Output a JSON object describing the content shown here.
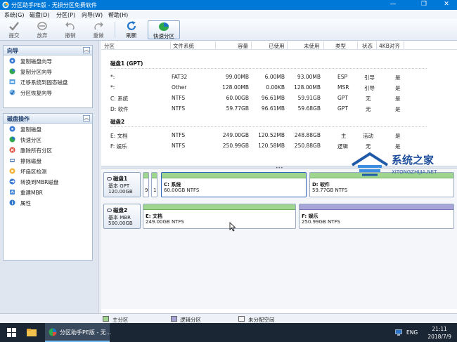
{
  "window": {
    "title": "分区助手PE版 - 无损分区免费软件"
  },
  "menu": [
    "系统(G)",
    "磁盘(D)",
    "分区(P)",
    "向导(W)",
    "帮助(H)"
  ],
  "toolbar": {
    "submit": "提交",
    "discard": "放弃",
    "undo": "撤销",
    "redo": "重做",
    "refresh": "刷新",
    "quick_partition": "快速分区"
  },
  "wizard_panel": {
    "title": "向导",
    "items": [
      "复制磁盘向导",
      "复制分区向导",
      "迁移系统到固态磁盘",
      "分区恢复向导"
    ]
  },
  "disk_ops_panel": {
    "title": "磁盘操作",
    "items": [
      "复制磁盘",
      "快速分区",
      "删除所有分区",
      "擦除磁盘",
      "坏扇区检测",
      "转换到MBR磁盘",
      "重建MBR",
      "属性"
    ]
  },
  "table": {
    "headers": [
      "分区",
      "文件系统",
      "容量",
      "已使用",
      "未使用",
      "类型",
      "状态",
      "4KB对齐"
    ],
    "disk1_title": "磁盘1 (GPT)",
    "disk1_rows": [
      [
        "*:",
        "FAT32",
        "99.00MB",
        "6.00MB",
        "93.00MB",
        "ESP",
        "引导",
        "是"
      ],
      [
        "*:",
        "Other",
        "128.00MB",
        "0.00KB",
        "128.00MB",
        "MSR",
        "引导",
        "是"
      ],
      [
        "C: 系统",
        "NTFS",
        "60.00GB",
        "96.61MB",
        "59.91GB",
        "GPT",
        "无",
        "是"
      ],
      [
        "D: 软件",
        "NTFS",
        "59.77GB",
        "96.61MB",
        "59.68GB",
        "GPT",
        "无",
        "是"
      ]
    ],
    "disk2_title": "磁盘2",
    "disk2_rows": [
      [
        "E: 文档",
        "NTFS",
        "249.00GB",
        "120.52MB",
        "248.88GB",
        "主",
        "活动",
        "是"
      ],
      [
        "F: 娱乐",
        "NTFS",
        "250.99GB",
        "120.58MB",
        "250.88GB",
        "逻辑",
        "无",
        "是"
      ]
    ]
  },
  "diskmap": {
    "disk1": {
      "name": "磁盘1",
      "type": "基本 GPT",
      "size": "120.00GB",
      "small1": "9",
      "small2": "1",
      "c_name": "C: 系统",
      "c_size": "60.00GB NTFS",
      "d_name": "D: 软件",
      "d_size": "59.77GB NTFS"
    },
    "disk2": {
      "name": "磁盘2",
      "type": "基本 MBR",
      "size": "500.00GB",
      "e_name": "E: 文档",
      "e_size": "249.00GB NTFS",
      "f_name": "F: 娱乐",
      "f_size": "250.99GB NTFS"
    }
  },
  "legend": {
    "primary": "主分区",
    "logical": "逻辑分区",
    "unallocated": "未分配空间"
  },
  "watermark": {
    "brand": "系统之家",
    "url": "XITONGZHIJIA.NET"
  },
  "taskbar": {
    "task_label": "分区助手PE版 - 无...",
    "lang": "ENG",
    "time": "21:11",
    "date": "2018/7/9"
  },
  "colors": {
    "titlebar": "#0078d7",
    "primary_partition": "#9fd58e",
    "logical_partition": "#a7a4d8"
  }
}
